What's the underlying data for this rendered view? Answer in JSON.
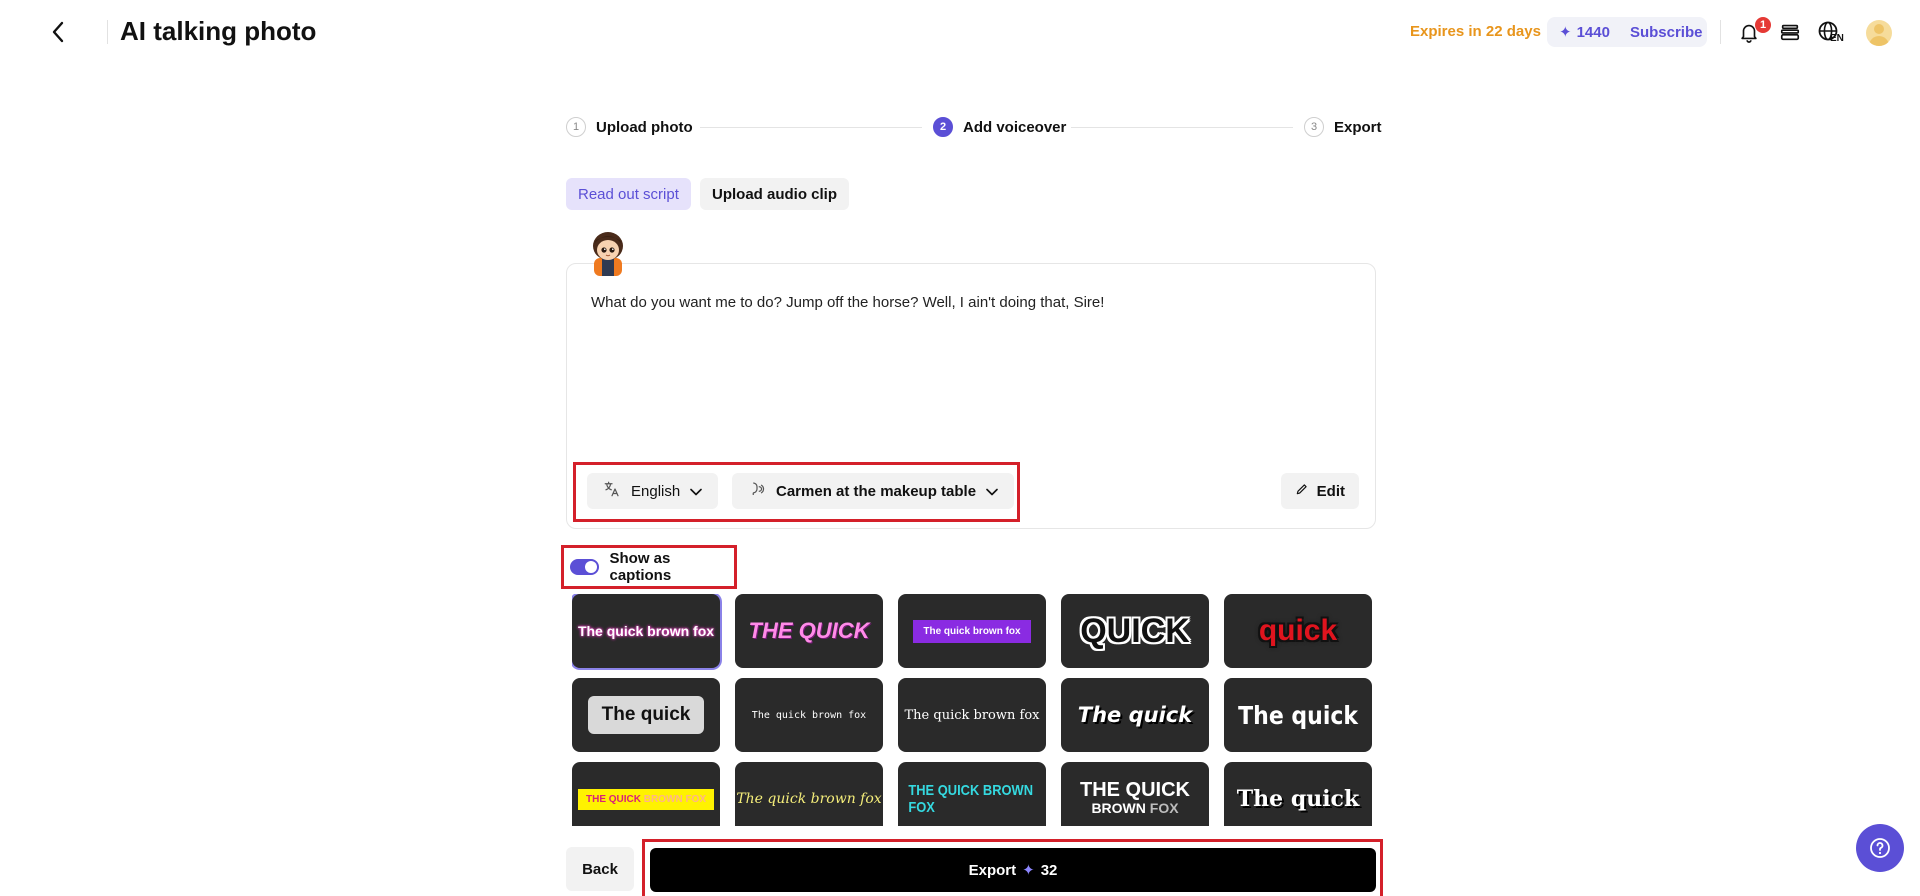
{
  "header": {
    "title": "AI talking photo",
    "expires": "Expires in 22 days",
    "credits": "1440",
    "subscribe_label": "Subscribe",
    "notification_count": "1",
    "language_code": "EN"
  },
  "stepper": {
    "steps": [
      {
        "number": "1",
        "label": "Upload photo"
      },
      {
        "number": "2",
        "label": "Add voiceover"
      },
      {
        "number": "3",
        "label": "Export"
      }
    ],
    "active_step": 2
  },
  "mode_tabs": {
    "read_out_script": "Read out script",
    "upload_audio_clip": "Upload audio clip",
    "active": "Read out script"
  },
  "script": {
    "text": "What do you want me to do? Jump off the horse? Well, I ain't doing that, Sire!",
    "language": "English",
    "voice": "Carmen at the makeup table",
    "edit_label": "Edit"
  },
  "captions": {
    "label": "Show as captions",
    "enabled": true
  },
  "caption_styles": [
    {
      "text": "The quick brown fox",
      "selected": true
    },
    {
      "text": "THE QUICK"
    },
    {
      "text": "The quick brown fox"
    },
    {
      "text": "QUICK"
    },
    {
      "text": "quick"
    },
    {
      "text": "The quick"
    },
    {
      "text": "The quick brown fox"
    },
    {
      "text": "The quick brown fox"
    },
    {
      "text": "The quick"
    },
    {
      "text": "The quick"
    },
    {
      "text_main": "THE QUICK",
      "text_dim": " BROWN FOX"
    },
    {
      "text": "The quick brown fox"
    },
    {
      "text": "THE QUICK BROWN FOX"
    },
    {
      "text_main": "THE QUICK",
      "text_sub": "BROWN",
      "text_sub_dim": " FOX"
    },
    {
      "text": "The quick"
    }
  ],
  "actions": {
    "back_label": "Back",
    "export_label": "Export",
    "export_cost": "32"
  },
  "colors": {
    "accent": "#5b4fd6",
    "warning": "#e8951c",
    "highlight_frame": "#d4202a"
  },
  "icons": [
    "back-arrow-icon",
    "bell-icon",
    "stack-icon",
    "globe-icon",
    "translate-icon",
    "voice-icon",
    "chevron-down-icon",
    "pencil-icon",
    "sparkle-icon",
    "help-icon"
  ]
}
